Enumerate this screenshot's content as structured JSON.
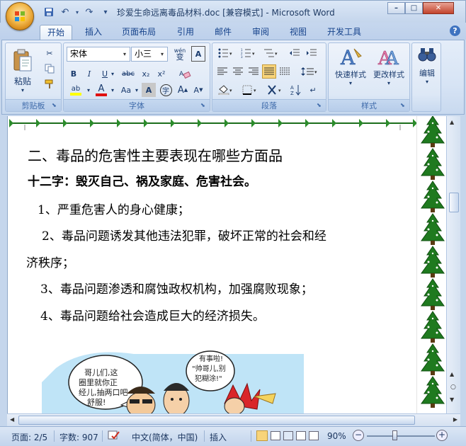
{
  "window": {
    "title": "珍爱生命远离毒品材料.doc [兼容模式] - Microsoft Word",
    "minimize": "–",
    "restore": "□",
    "close": "✕"
  },
  "qat": {
    "save": "💾",
    "undo": "↶",
    "redo": "↷",
    "more": "▾"
  },
  "tabs": [
    "开始",
    "插入",
    "页面布局",
    "引用",
    "邮件",
    "审阅",
    "视图",
    "开发工具"
  ],
  "help": "?",
  "ribbon": {
    "clipboard": {
      "paste": "粘贴",
      "label": "剪贴板"
    },
    "font": {
      "name": "宋体",
      "size": "小三",
      "wen": "wén",
      "wen2": "变",
      "label": "字体",
      "bold": "B",
      "italic": "I",
      "underline": "U",
      "strike": "abc",
      "sub": "x₂",
      "sup": "x²",
      "aa": "Aa",
      "color_a": "A",
      "grow": "A",
      "shrink": "A",
      "highlight": "ab",
      "char_a": "A",
      "enc": "字"
    },
    "paragraph": {
      "label": "段落"
    },
    "styles": {
      "quick": "快速样式",
      "change": "更改样式",
      "label": "样式"
    },
    "edit": {
      "label": "编辑"
    }
  },
  "document": {
    "heading": "二、毒品的危害性主要表现在哪些方面品",
    "subheading": "十二字：毁灭自己、祸及家庭、危害社会。",
    "items": [
      "1、严重危害人的身心健康；",
      "2、毒品问题诱发其他违法犯罪，破坏正常的社会和经",
      "济秩序；",
      "3、毒品问题渗透和腐蚀政权机构，加强腐败现象；",
      "4、毒品问题给社会造成巨大的经济损失。"
    ],
    "cartoon_text": {
      "bubble1": "哥儿们,这圈里就你正经儿,抽两口吧,舒服!",
      "bubble2": "有事啦!\"帅哥儿,别犯糊涂!\""
    }
  },
  "status": {
    "page": "页面: 2/5",
    "words": "字数: 907",
    "lang": "中文(简体，中国)",
    "insert": "插入",
    "zoom": "90%"
  }
}
